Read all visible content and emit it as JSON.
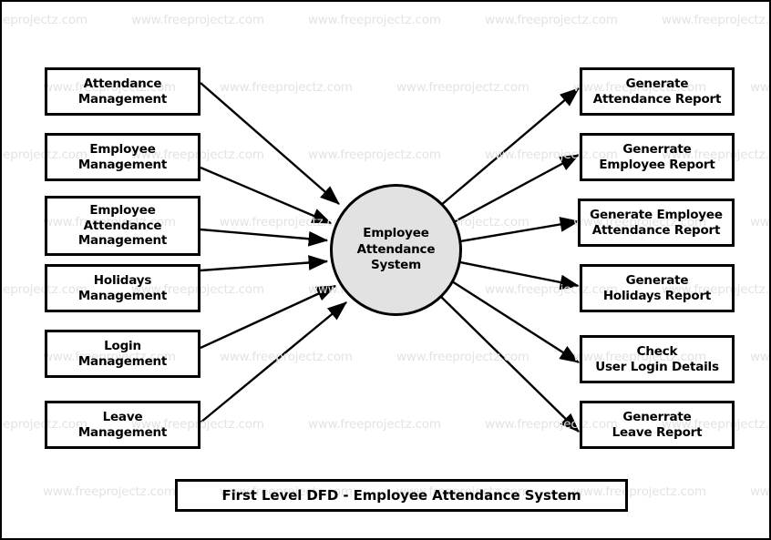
{
  "diagram": {
    "title": "First Level DFD - Employee Attendance System",
    "watermark_text": "www.freeprojectz.com",
    "process": {
      "label": "Employee\nAttendance\nSystem",
      "fill_color": "#e2e2e2",
      "stroke_color": "#000000"
    },
    "inputs": [
      {
        "label": "Attendance\nManagement"
      },
      {
        "label": "Employee\nManagement"
      },
      {
        "label": "Employee\nAttendance\nManagement"
      },
      {
        "label": "Holidays\nManagement"
      },
      {
        "label": "Login\nManagement"
      },
      {
        "label": "Leave\nManagement"
      }
    ],
    "outputs": [
      {
        "label": "Generate\nAttendance Report"
      },
      {
        "label": "Generrate\nEmployee Report"
      },
      {
        "label": "Generate Employee\nAttendance Report"
      },
      {
        "label": "Generate\nHolidays Report"
      },
      {
        "label": "Check\nUser Login Details"
      },
      {
        "label": "Generrate\nLeave Report"
      }
    ]
  }
}
